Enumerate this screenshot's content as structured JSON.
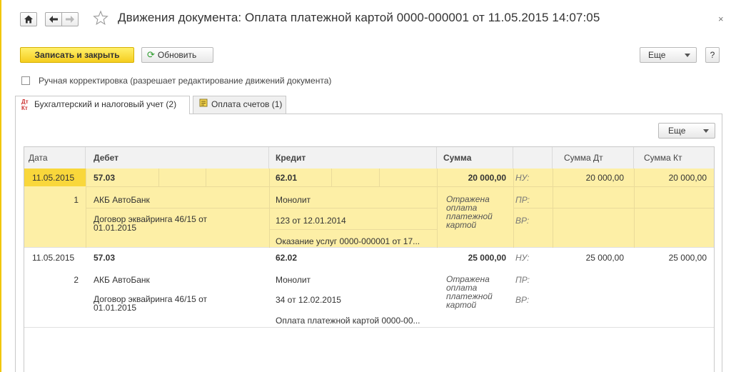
{
  "window": {
    "title": "Движения документа: Оплата платежной картой 0000-000001 от 11.05.2015 14:07:05",
    "close": "×"
  },
  "toolbar": {
    "save_close": "Записать и закрыть",
    "refresh": "Обновить",
    "more": "Еще",
    "help": "?"
  },
  "manual_correction": {
    "label": "Ручная корректировка (разрешает редактирование движений документа)",
    "checked": false
  },
  "tabs": [
    {
      "label": "Бухгалтерский и налоговый учет (2)",
      "icon": "dt-kt-icon",
      "active": true
    },
    {
      "label": "Оплата счетов (1)",
      "icon": "register-icon",
      "active": false
    }
  ],
  "panel": {
    "more": "Еще"
  },
  "table": {
    "columns": [
      "Дата",
      "Дебет",
      "Кредит",
      "Сумма",
      "",
      "Сумма Дт",
      "Сумма Кт"
    ],
    "rows": [
      {
        "date": "11.05.2015",
        "number": "1",
        "debit_account": "57.03",
        "debit_sub1": "АКБ АвтоБанк",
        "debit_sub2": "Договор эквайринга 46/15 от 01.01.2015",
        "credit_account": "62.01",
        "credit_sub1": "Монолит",
        "credit_sub2": "123 от 12.01.2014",
        "credit_sub3": "Оказание услуг 0000-000001 от 17...",
        "amount": "20 000,00",
        "content": "Отражена оплата платежной картой",
        "nu_label": "НУ:",
        "pr_label": "ПР:",
        "vr_label": "ВР:",
        "amount_dt": "20 000,00",
        "amount_kt": "20 000,00",
        "selected": true
      },
      {
        "date": "11.05.2015",
        "number": "2",
        "debit_account": "57.03",
        "debit_sub1": "АКБ АвтоБанк",
        "debit_sub2": "Договор эквайринга 46/15 от 01.01.2015",
        "credit_account": "62.02",
        "credit_sub1": "Монолит",
        "credit_sub2": "34 от 12.02.2015",
        "credit_sub3": "Оплата платежной картой 0000-00...",
        "amount": "25 000,00",
        "content": "Отражена оплата платежной картой",
        "nu_label": "НУ:",
        "pr_label": "ПР:",
        "vr_label": "ВР:",
        "amount_dt": "25 000,00",
        "amount_kt": "25 000,00",
        "selected": false
      }
    ]
  },
  "colors": {
    "primary_button": "#f5cd1f",
    "selected_row": "#fdefa6",
    "selected_cell": "#f9d73b",
    "refresh_icon": "#2b9b2b"
  }
}
